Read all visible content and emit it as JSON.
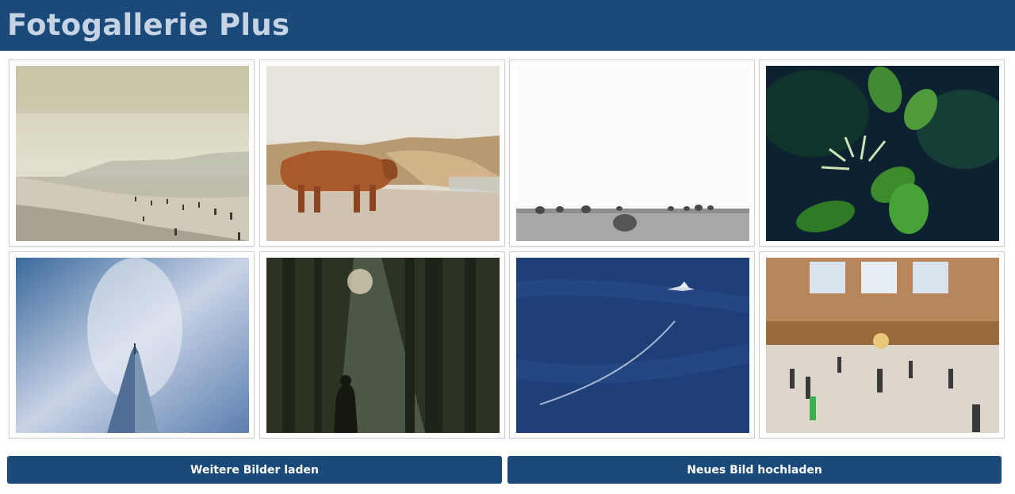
{
  "app": {
    "title": "Fotogallerie Plus"
  },
  "gallery": {
    "photos": [
      {
        "subject": "misty-beach"
      },
      {
        "subject": "highland-cow-coast"
      },
      {
        "subject": "hay-bales-field"
      },
      {
        "subject": "green-plant-leaves"
      },
      {
        "subject": "skyscraper-clouds"
      },
      {
        "subject": "forest-sunrays-person"
      },
      {
        "subject": "ocean-bird"
      },
      {
        "subject": "station-hall-crowd"
      }
    ]
  },
  "actions": {
    "load_more_label": "Weitere Bilder laden",
    "upload_label": "Neues Bild hochladen"
  },
  "colors": {
    "header_bg": "#1a4a7a",
    "header_text": "#c6d3e3",
    "button_bg": "#1a4a7a",
    "button_text": "#ffffff"
  }
}
